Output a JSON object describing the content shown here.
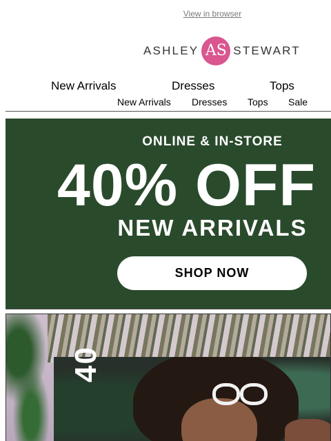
{
  "header": {
    "view_in_browser": "View in browser",
    "logo": {
      "left": "ASHLEY",
      "monogram": "AS",
      "right": "STEWART"
    }
  },
  "nav_primary": [
    "New Arrivals",
    "Dresses",
    "Tops"
  ],
  "nav_secondary": [
    "New Arrivals",
    "Dresses",
    "Tops",
    "Sale"
  ],
  "hero": {
    "eyebrow": "ONLINE & IN-STORE",
    "headline": "40% OFF",
    "subheadline": "NEW ARRIVALS",
    "cta": "SHOP NOW",
    "background_color": "#2a4a2c"
  },
  "promo2": {
    "vertical_text": "40"
  },
  "colors": {
    "brand_pink": "#d9568f",
    "hero_green": "#2a4a2c"
  }
}
